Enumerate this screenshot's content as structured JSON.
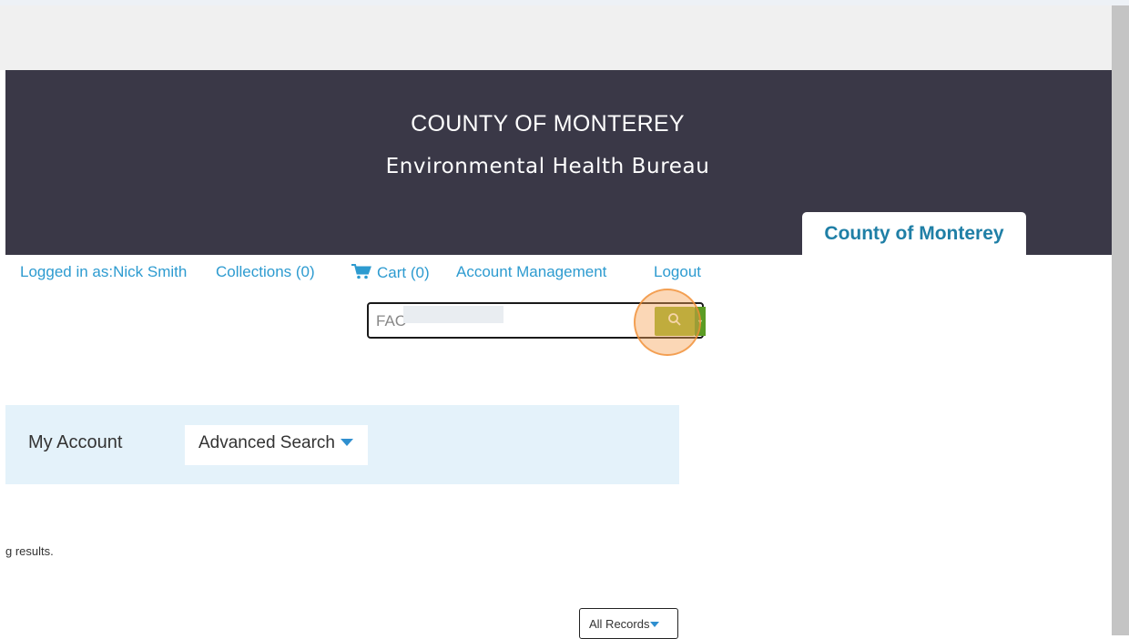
{
  "header": {
    "agency_line1": "COUNTY OF MONTEREY",
    "agency_line2": "Environmental Health Bureau",
    "tab_label": "County of Monterey"
  },
  "user_links": {
    "logged_in": "Logged in as:Nick Smith",
    "collections": "Collections (0)",
    "cart": "Cart (0)",
    "account_management": "Account Management",
    "logout": "Logout"
  },
  "search": {
    "value": "FAC",
    "button_icon": "search-icon",
    "dropdown_icon": "chevron-down-icon"
  },
  "nav": {
    "my_account": "My Account",
    "advanced_search": "Advanced Search"
  },
  "main": {
    "results_text": "g results.",
    "records_filter": "All Records"
  },
  "colors": {
    "header_bg": "#3a3847",
    "link": "#2d9bd0",
    "nav_bg": "#e4f2fa",
    "search_btn": "#9ab530",
    "tab_text": "#1f7fa6"
  }
}
